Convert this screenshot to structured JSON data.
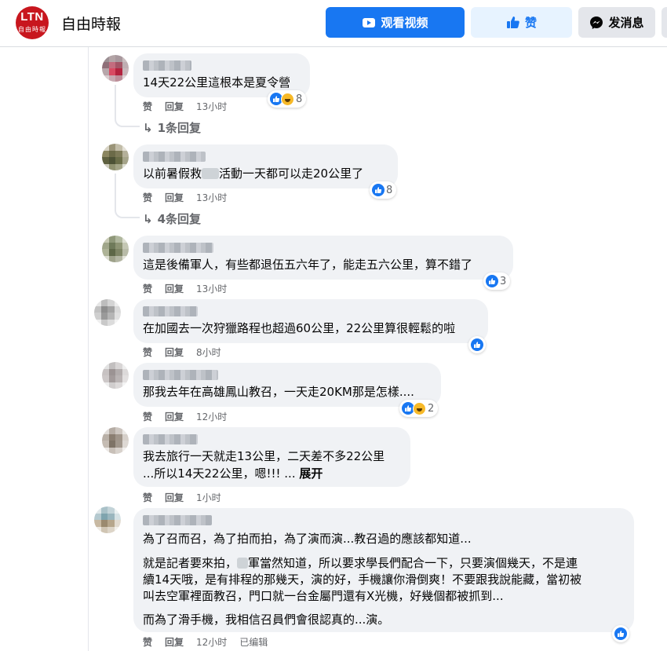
{
  "header": {
    "logo_top": "LTN",
    "logo_bottom": "自由時報",
    "page_name": "自由時報",
    "watch_label": "观看视频",
    "like_label": "赞",
    "message_label": "发消息"
  },
  "comments": [
    {
      "text": "14天22公里這根本是夏令營",
      "reactions": [
        "like",
        "haha"
      ],
      "reaction_count": "8",
      "actions": [
        "赞",
        "回复"
      ],
      "time": "13小时",
      "replies": "1条回复"
    },
    {
      "text_before": "以前暑假救",
      "text_after": "活動一天都可以走20公里了",
      "reactions": [
        "like"
      ],
      "reaction_count": "8",
      "actions": [
        "赞",
        "回复"
      ],
      "time": "13小时",
      "replies": "4条回复"
    },
    {
      "text": "這是後備軍人，有些都退伍五六年了，能走五六公里，算不錯了",
      "reactions": [
        "like"
      ],
      "reaction_count": "3",
      "actions": [
        "赞",
        "回复"
      ],
      "time": "13小时"
    },
    {
      "text": "在加國去一次狩獵路程也超過60公里，22公里算很輕鬆的啦",
      "reactions": [
        "like"
      ],
      "reaction_count": "",
      "actions": [
        "赞",
        "回复"
      ],
      "time": "8小时"
    },
    {
      "text": "那我去年在高雄鳳山教召，一天走20KM那是怎樣....",
      "reactions": [
        "like",
        "haha"
      ],
      "reaction_count": "2",
      "actions": [
        "赞",
        "回复"
      ],
      "time": "12小时"
    },
    {
      "line1": "我去旅行一天就走13公里，二天差不多22公里",
      "line2": "...所以14天22公里，嗯!!! ...",
      "see_more": "展开",
      "actions": [
        "赞",
        "回复"
      ],
      "time": "1小时"
    },
    {
      "p1": "為了召而召，為了拍而拍，為了演而演...教召過的應該都知道...",
      "p2_l1_before": "就是記者要來拍，",
      "p2_l1_after": "軍當然知道，所以要求學長們配合一下，只要演個幾天，不是連",
      "p2_l2": "續14天哦，是有排程的那幾天，演的好，手機讓你滑倒爽！不要跟我說能藏，當初被",
      "p2_l3": "叫去空軍裡面教召，門口就一台金屬門還有X光機，好幾個都被抓到...",
      "p3": "而為了滑手機，我相信召員們會很認真的...演。",
      "reactions": [
        "like"
      ],
      "actions": [
        "赞",
        "回复"
      ],
      "time": "12小时",
      "edited": "已编辑"
    }
  ],
  "colors": {
    "primary": "#1877f2",
    "bubble": "#f0f2f5",
    "meta": "#65676b",
    "logo": "#c8161e"
  }
}
